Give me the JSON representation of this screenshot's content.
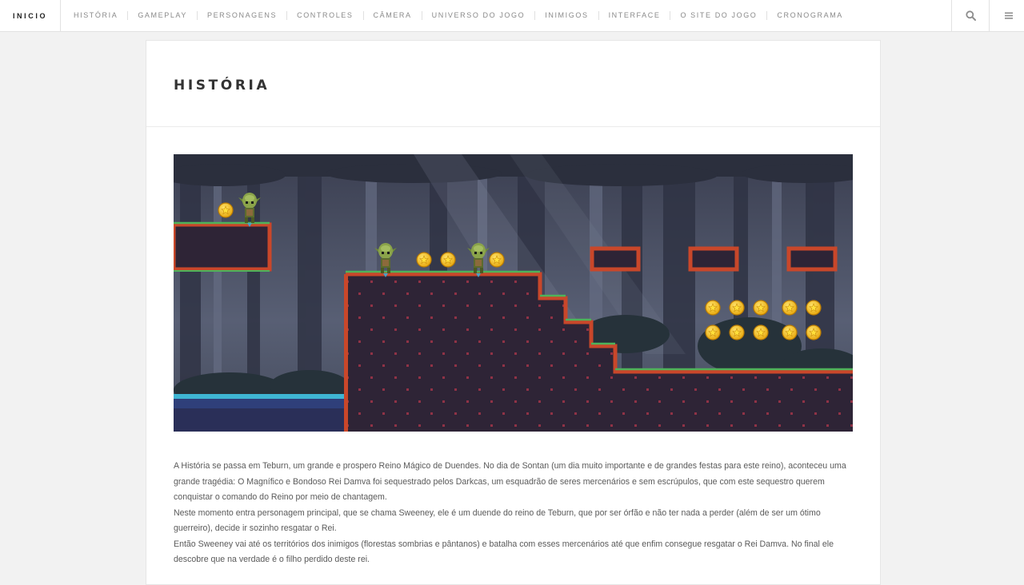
{
  "nav": {
    "brand": "INICIO",
    "items": [
      {
        "label": "HISTÓRIA"
      },
      {
        "label": "GAMEPLAY"
      },
      {
        "label": "PERSONAGENS"
      },
      {
        "label": "CONTROLES"
      },
      {
        "label": "CÂMERA"
      },
      {
        "label": "UNIVERSO DO JOGO"
      },
      {
        "label": "INIMIGOS"
      },
      {
        "label": "INTERFACE"
      },
      {
        "label": "O SITE DO JOGO"
      },
      {
        "label": "CRONOGRAMA"
      }
    ],
    "search_icon": "search-icon",
    "menu_icon": "hamburger-menu-icon"
  },
  "article": {
    "title": "HISTÓRIA",
    "paragraphs": [
      "A História se passa em Teburn, um grande e prospero Reino Mágico de Duendes. No dia de Sontan (um dia muito importante e de grandes festas para este reino), aconteceu uma grande tragédia: O Magnífico e Bondoso Rei Damva foi sequestrado pelos Darkcas, um esquadrão de seres mercenários e sem escrúpulos, que com este sequestro querem conquistar o comando do Reino por meio de chantagem.",
      "Neste momento entra personagem principal, que se chama Sweeney, ele é um duende do reino de Teburn, que por ser órfão e não ter nada a perder (além de ser um ótimo guerreiro), decide ir sozinho resgatar o Rei.",
      "Então Sweeney vai até os territórios dos inimigos (florestas sombrias e pântanos) e batalha com esses mercenários até que enfim consegue resgatar o Rei Damva. No final ele descobre que na verdade é o filho perdido deste rei."
    ]
  },
  "colors": {
    "page_bg": "#f2f2f2",
    "card_bg": "#ffffff",
    "title": "#333333",
    "nav_text": "#8a8a8a",
    "game_sky": "#4a4f63",
    "game_ground": "#2e2436",
    "game_ember": "#c9472a",
    "game_grass": "#4fb35a",
    "game_water": "#3fb6d4",
    "coin": "#f5c518"
  }
}
